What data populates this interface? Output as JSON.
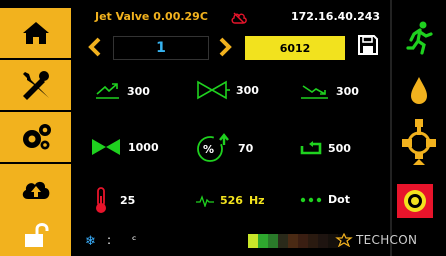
{
  "header": {
    "title": "Jet Valve 0.00.29C",
    "ip": "172.16.40.243"
  },
  "selector": {
    "channel": "1",
    "value": "6012"
  },
  "params": {
    "open_time": "300",
    "valve_time": "300",
    "close_time": "300",
    "pulses": "1000",
    "percent": "70",
    "cycles": "500",
    "temperature": "25",
    "frequency": "526",
    "frequency_unit": "Hz",
    "mode": "Dot"
  },
  "status": {
    "colon": ":",
    "temp_unit": "ᶜ",
    "brand": "TECHCON"
  },
  "icons": {
    "home": "home-icon",
    "tools": "tools-icon",
    "settings": "gears-icon",
    "cloud": "cloud-upload-icon",
    "lock": "unlock-icon",
    "run": "runner-icon",
    "drop": "drop-icon",
    "valve": "valve-icon",
    "target": "target-icon",
    "save": "save-icon"
  },
  "colors": {
    "accent_yellow": "#f2b21e",
    "accent_green": "#1fd11f",
    "accent_blue": "#36b3f0",
    "alarm_red": "#e8142b"
  },
  "heater_gradient": [
    "#c8e62a",
    "#2ea82e",
    "#2a7a2a",
    "#2a2a1a",
    "#4a2a14",
    "#3a1e12",
    "#2a1a10",
    "#1e1410",
    "#15100c",
    "#0a0808"
  ]
}
